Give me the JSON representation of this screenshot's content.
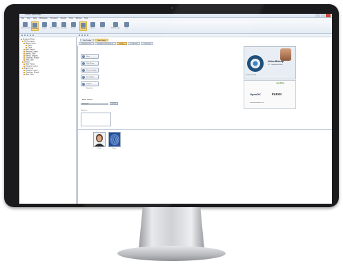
{
  "window": {
    "title": "UniCom - Batch Mode"
  },
  "menu": [
    "File",
    "View",
    "Data",
    "Workspace",
    "Personnel",
    "Reports",
    "Tools",
    "Window",
    "Help"
  ],
  "ribbon": [
    {
      "label": "New Personnel"
    },
    {
      "label": "Personnel",
      "selected": true
    },
    {
      "label": "Badges"
    },
    {
      "label": "Access Levels"
    },
    {
      "label": "Schedules"
    },
    {
      "label": "Readers"
    },
    {
      "label": "Layouts",
      "selected": true
    },
    {
      "label": "Alarms"
    },
    {
      "label": "Events"
    },
    {
      "label": "EPM Manager"
    },
    {
      "label": "Tools"
    }
  ],
  "tree": {
    "title": "Employee Roles",
    "nodes": [
      "All Companies",
      "Bishop, Helen",
      "Guest",
      "Client",
      "Wall, Patrick",
      "Vasquez, Lauren",
      "Barnes, Theo",
      "Ramos, Gregory",
      "Goodman, Russell",
      "Wise, John",
      "Service",
      "Wall, Patrick",
      "Vasquez, Lauren",
      "Engineering",
      "Vasquez, Lauren",
      "Goodman, Russell",
      "Wise, John"
    ]
  },
  "tabs_top": [
    "Tabs Toolbar",
    "Batch Mode"
  ],
  "tabs_second": [
    "Employee Info",
    "Employee Info (Page 2)",
    "Badges",
    "Card Data",
    "Card Data"
  ],
  "actions": [
    "Print",
    "Take Photo",
    "Process Badge",
    "Print Badge",
    "Capture Signature"
  ],
  "batch": {
    "title": "Batch Transfer",
    "field": "Print Batch",
    "button": "Refresh"
  },
  "signature_label": "Signature",
  "thumbnails": [
    {
      "caption": "Photo"
    },
    {
      "caption": "Finger 1"
    }
  ],
  "card": {
    "company": "OPEN OPTIONS",
    "name": "Helen Bishop",
    "role": "VP - Operations/Sales",
    "website": "www.openoptions.com"
  },
  "card2": {
    "brand1": "OpenDX",
    "brand2": "FLEXII",
    "brand3": "openRelay"
  },
  "colors": {
    "accent": "#f6d98a",
    "frame": "#1b1b1d",
    "ribbon": "#e4ebf4"
  }
}
